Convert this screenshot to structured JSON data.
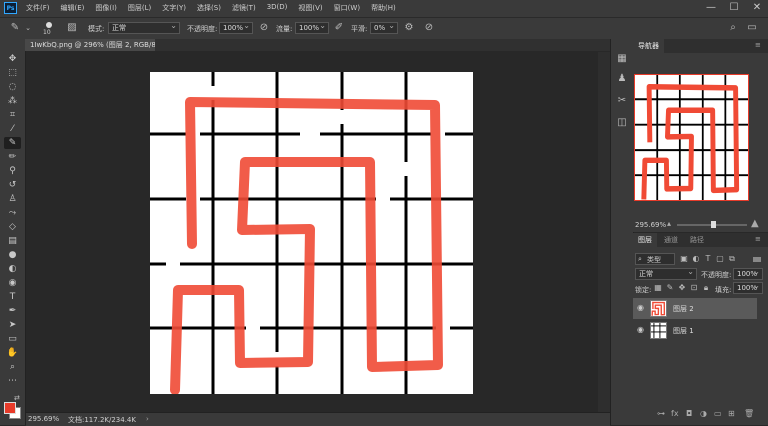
{
  "app": {
    "logo": "Ps"
  },
  "menubar": {
    "items": [
      "文件(F)",
      "编辑(E)",
      "图像(I)",
      "图层(L)",
      "文字(Y)",
      "选择(S)",
      "滤镜(T)",
      "3D(D)",
      "视图(V)",
      "窗口(W)",
      "帮助(H)"
    ]
  },
  "window_controls": {
    "minimize": "—",
    "maximize": "☐",
    "close": "✕"
  },
  "options": {
    "brush_size": "10",
    "mode_label": "模式:",
    "mode_value": "正常",
    "opacity_label": "不透明度:",
    "opacity_value": "100%",
    "flow_label": "流量:",
    "flow_value": "100%",
    "smooth_label": "平滑:",
    "smooth_value": "0%"
  },
  "document": {
    "tab_title": "1IwKbQ.png @ 296% (图层 2, RGB/8) *",
    "tab_close": "×"
  },
  "status": {
    "zoom": "295.69%",
    "doc_info": "文档:117.2K/234.4K"
  },
  "navigator": {
    "tab": "导航器",
    "zoom": "295.69%"
  },
  "layers_panel": {
    "tabs": [
      "图层",
      "通道",
      "路径"
    ],
    "kind_filter": "类型",
    "blend_mode": "正常",
    "opacity_label": "不透明度:",
    "opacity_value": "100%",
    "lock_label": "锁定:",
    "fill_label": "填充:",
    "fill_value": "100%",
    "layers": [
      {
        "name": "图层 2",
        "selected": true
      },
      {
        "name": "图层 1",
        "selected": false
      }
    ],
    "bottom_icons": [
      "link-icon",
      "fx-icon",
      "mask-icon",
      "adjustment-icon",
      "group-icon",
      "new-layer-icon",
      "trash-icon"
    ]
  },
  "colors": {
    "foreground": "#e83b2a",
    "background": "#ffffff",
    "stroke": "#f04a35",
    "grid": "#000000"
  }
}
